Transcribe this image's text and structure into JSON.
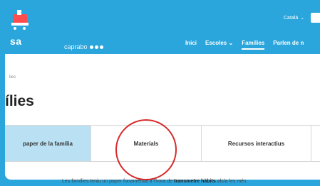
{
  "header": {
    "logo_text": "sa",
    "partner": "caprabo",
    "language": "Català",
    "nav": [
      "Inici",
      "Escoles",
      "Famílies",
      "Parlen de n"
    ],
    "active_nav": "Famílies"
  },
  "content": {
    "breadcrumb": "lies",
    "title": "ílies",
    "tabs": [
      {
        "label": "paper de la família",
        "active": true
      },
      {
        "label": "Materials",
        "active": false
      },
      {
        "label": "Recursos interactius",
        "active": false
      }
    ],
    "intro_pre": "Les famílies teniu un paper fonamental a l'hora de ",
    "intro_bold": "transmetre hàbits",
    "intro_post": " als/a les més"
  },
  "colors": {
    "brand_blue": "#2aa6dc",
    "active_tab": "#b9e1f3",
    "highlight": "#d82a2a"
  },
  "icons": [
    "cart-logo-icon",
    "chevron-down-icon"
  ]
}
